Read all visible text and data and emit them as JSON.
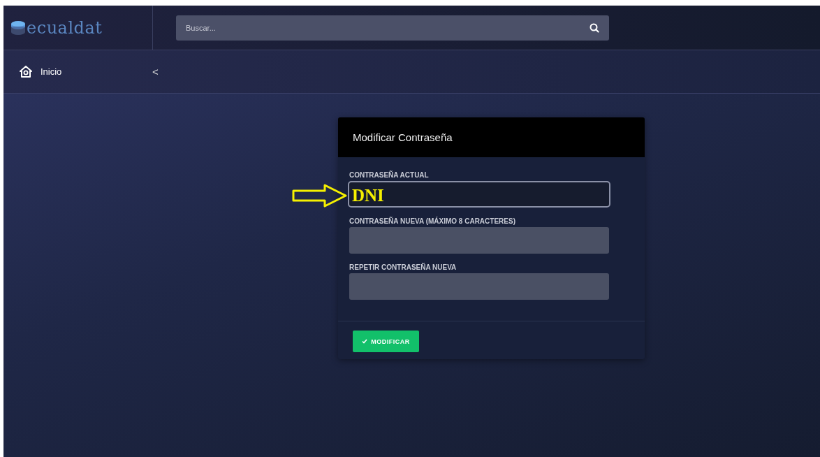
{
  "header": {
    "logo": "ecualdat",
    "search": {
      "placeholder": "Buscar..."
    }
  },
  "nav": {
    "items": [
      {
        "label": "Inicio"
      }
    ],
    "collapse": "<"
  },
  "card": {
    "title": "Modificar Contraseña",
    "fields": [
      {
        "label": "CONTRASEÑA ACTUAL",
        "focused": true
      },
      {
        "label": "CONTRASEÑA NUEVA (MÁXIMO 8 CARACTERES)",
        "focused": false
      },
      {
        "label": "REPETIR CONTRASEÑA NUEVA",
        "focused": false
      }
    ],
    "button": "MODIFICAR"
  },
  "annotation": {
    "text": "DNI"
  }
}
